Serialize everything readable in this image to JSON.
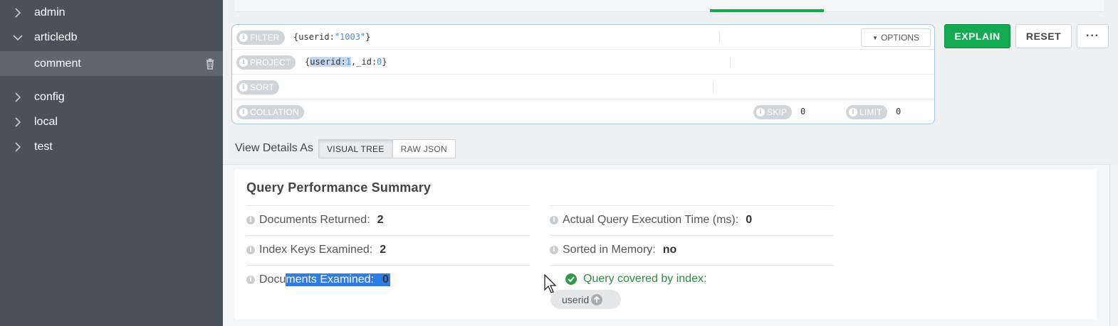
{
  "sidebar": {
    "items": [
      {
        "label": "admin",
        "expanded": false
      },
      {
        "label": "articledb",
        "expanded": true
      },
      {
        "label": "comment",
        "selected": true
      },
      {
        "label": "config",
        "expanded": false
      },
      {
        "label": "local",
        "expanded": false
      },
      {
        "label": "test",
        "expanded": false
      }
    ]
  },
  "querybar": {
    "filter_label": "FILTER",
    "filter_value_open": "{userid:",
    "filter_value_str": "\"1003\"",
    "filter_value_close": "}",
    "options_label": "OPTIONS",
    "project_label": "PROJECT",
    "project_open": "{",
    "project_key": "userid:",
    "project_key_val": "1",
    "project_rest": ",_id:",
    "project_rest_val": "0",
    "project_close": "}",
    "sort_label": "SORT",
    "collation_label": "COLLATION",
    "skip_label": "SKIP",
    "skip_value": "0",
    "limit_label": "LIMIT",
    "limit_value": "0"
  },
  "actions": {
    "explain": "EXPLAIN",
    "reset": "RESET",
    "more": "···"
  },
  "view_details": {
    "label": "View Details As",
    "options": [
      "VISUAL TREE",
      "RAW JSON"
    ],
    "active": "VISUAL TREE"
  },
  "summary": {
    "title": "Query Performance Summary",
    "docs_returned_label": "Documents Returned:",
    "docs_returned_value": "2",
    "index_keys_label": "Index Keys Examined:",
    "index_keys_value": "2",
    "docs_examined_label_a": "Docu",
    "docs_examined_label_b": "ments Examined:",
    "docs_examined_value": "0",
    "exec_time_label": "Actual Query Execution Time (ms):",
    "exec_time_value": "0",
    "sorted_label": "Sorted in Memory:",
    "sorted_value": "no",
    "covered_label": "Query covered by index:",
    "index_name": "userid"
  },
  "colors": {
    "accent": "#13aa52",
    "sidebar": "#4a5158",
    "selection": "#2f7de1"
  }
}
